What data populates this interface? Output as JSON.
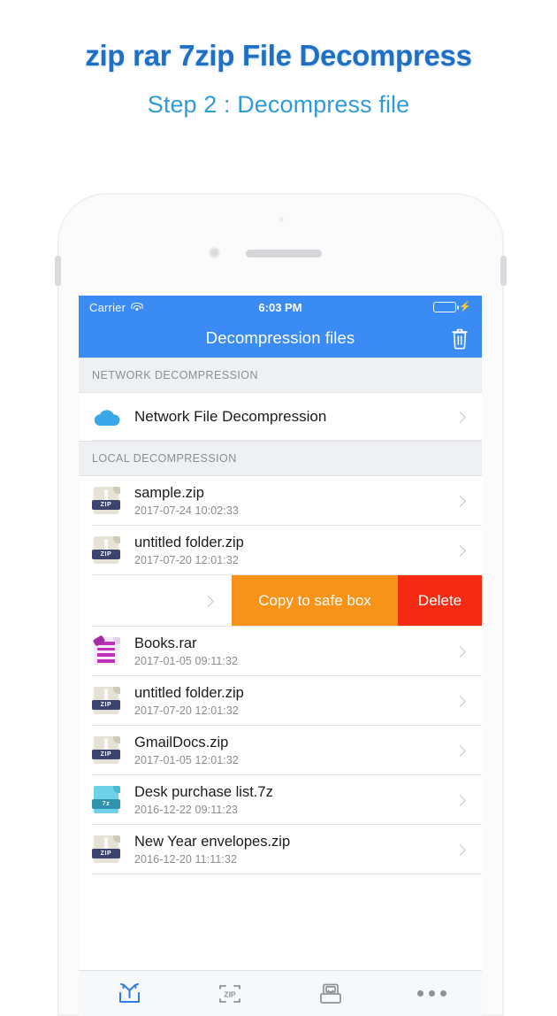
{
  "promo": {
    "title": "zip rar 7zip File Decompress",
    "subtitle": "Step 2 : Decompress file"
  },
  "colors": {
    "accent_blue": "#3b8bf4",
    "promo_title": "#1f6fc4",
    "promo_subtitle": "#2f9bdd",
    "action_copy": "#f79319",
    "action_delete": "#f42a12",
    "battery_green": "#49e06a"
  },
  "statusbar": {
    "carrier": "Carrier",
    "wifi_icon": "wifi-icon",
    "time": "6:03 PM",
    "battery_icon": "battery-icon",
    "charging_icon": "lightning-bolt-icon"
  },
  "navbar": {
    "title": "Decompression files",
    "trash_icon": "trash-icon"
  },
  "sections": [
    {
      "header": "NETWORK DECOMPRESSION",
      "rows": [
        {
          "icon": "cloud-icon",
          "title": "Network File Decompression",
          "subtitle": ""
        }
      ]
    },
    {
      "header": "LOCAL DECOMPRESSION",
      "rows": [
        {
          "icon": "zip-file-icon",
          "label": "ZIP",
          "title": "sample.zip",
          "subtitle": "2017-07-24 10:02:33"
        },
        {
          "icon": "zip-file-icon",
          "label": "ZIP",
          "title": "untitled folder.zip",
          "subtitle": "2017-07-20 12:01:32"
        },
        {
          "icon": "rar-file-icon",
          "label": "RAR",
          "title": "Books.rar",
          "subtitle": "2017-01-05 09:11:32"
        },
        {
          "icon": "zip-file-icon",
          "label": "ZIP",
          "title": "untitled folder.zip",
          "subtitle": "2017-07-20 12:01:32"
        },
        {
          "icon": "zip-file-icon",
          "label": "ZIP",
          "title": "GmailDocs.zip",
          "subtitle": "2017-01-05 12:01:32"
        },
        {
          "icon": "7z-file-icon",
          "label": "7z",
          "title": "Desk purchase list.7z",
          "subtitle": "2016-12-22 09:11:23"
        },
        {
          "icon": "zip-file-icon",
          "label": "ZIP",
          "title": "New Year envelopes.zip",
          "subtitle": "2016-12-20 11:11:32"
        }
      ]
    }
  ],
  "swipe_actions": {
    "copy_label": "Copy to safe box",
    "delete_label": "Delete"
  },
  "tabbar": {
    "items": [
      {
        "icon": "decompress-icon",
        "active": true
      },
      {
        "icon": "zip-icon",
        "active": false
      },
      {
        "icon": "safebox-icon",
        "active": false
      },
      {
        "icon": "more-icon",
        "active": false
      }
    ]
  }
}
